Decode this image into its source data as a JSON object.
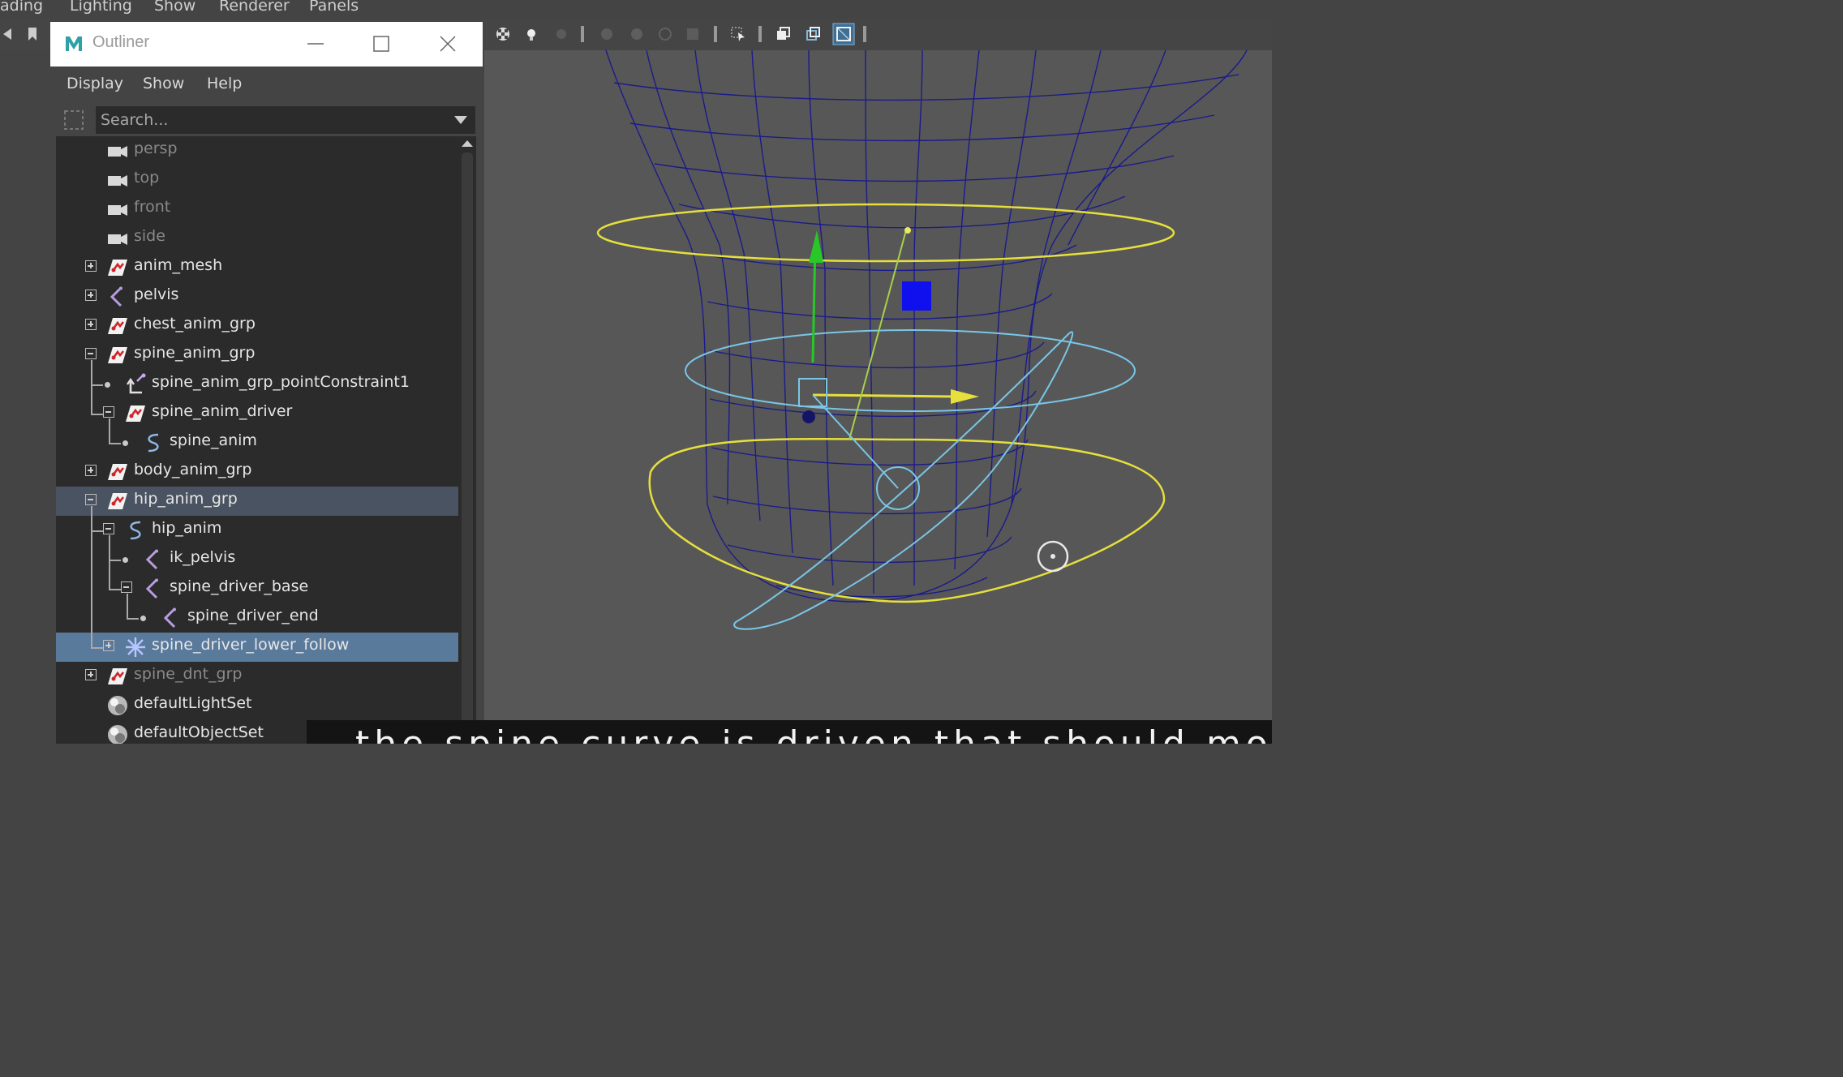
{
  "menubar": {
    "items": [
      "ading",
      "Lighting",
      "Show",
      "Renderer",
      "Panels"
    ]
  },
  "outliner": {
    "title": "Outliner",
    "menu": [
      "Display",
      "Show",
      "Help"
    ],
    "search": {
      "placeholder": "Search...",
      "value": ""
    },
    "items": [
      {
        "label": "persp",
        "icon": "camera-icon",
        "dim": true
      },
      {
        "label": "top",
        "icon": "camera-icon",
        "dim": true
      },
      {
        "label": "front",
        "icon": "camera-icon",
        "dim": true
      },
      {
        "label": "side",
        "icon": "camera-icon",
        "dim": true
      },
      {
        "label": "anim_mesh",
        "icon": "transform-icon",
        "expander": "plus"
      },
      {
        "label": "pelvis",
        "icon": "joint-icon",
        "expander": "plus"
      },
      {
        "label": "chest_anim_grp",
        "icon": "transform-icon",
        "expander": "plus"
      },
      {
        "label": "spine_anim_grp",
        "icon": "transform-icon",
        "expander": "minus"
      },
      {
        "label": "spine_anim_grp_pointConstraint1",
        "icon": "constraint-icon"
      },
      {
        "label": "spine_anim_driver",
        "icon": "transform-icon",
        "expander": "minus"
      },
      {
        "label": "spine_anim",
        "icon": "curve-icon"
      },
      {
        "label": "body_anim_grp",
        "icon": "transform-icon",
        "expander": "plus"
      },
      {
        "label": "hip_anim_grp",
        "icon": "transform-icon",
        "expander": "minus",
        "state": "highlighted"
      },
      {
        "label": "hip_anim",
        "icon": "curve-icon",
        "expander": "minus"
      },
      {
        "label": "ik_pelvis",
        "icon": "joint-icon"
      },
      {
        "label": "spine_driver_base",
        "icon": "joint-icon",
        "expander": "minus"
      },
      {
        "label": "spine_driver_end",
        "icon": "joint-icon"
      },
      {
        "label": "spine_driver_lower_follow",
        "icon": "locator-icon",
        "expander": "plus",
        "state": "selected"
      },
      {
        "label": "spine_dnt_grp",
        "icon": "transform-icon",
        "expander": "plus",
        "dim": true
      },
      {
        "label": "defaultLightSet",
        "icon": "set-icon"
      },
      {
        "label": "defaultObjectSet",
        "icon": "set-icon"
      }
    ]
  },
  "subtitle": {
    "text": "the spine curve is driven that should move the"
  },
  "colors": {
    "selected": "#5a7a9c",
    "highlighted": "#4a5361",
    "wire": "#1a1a8c",
    "yellow": "#e8e04a",
    "cyan": "#7ec8e8"
  }
}
